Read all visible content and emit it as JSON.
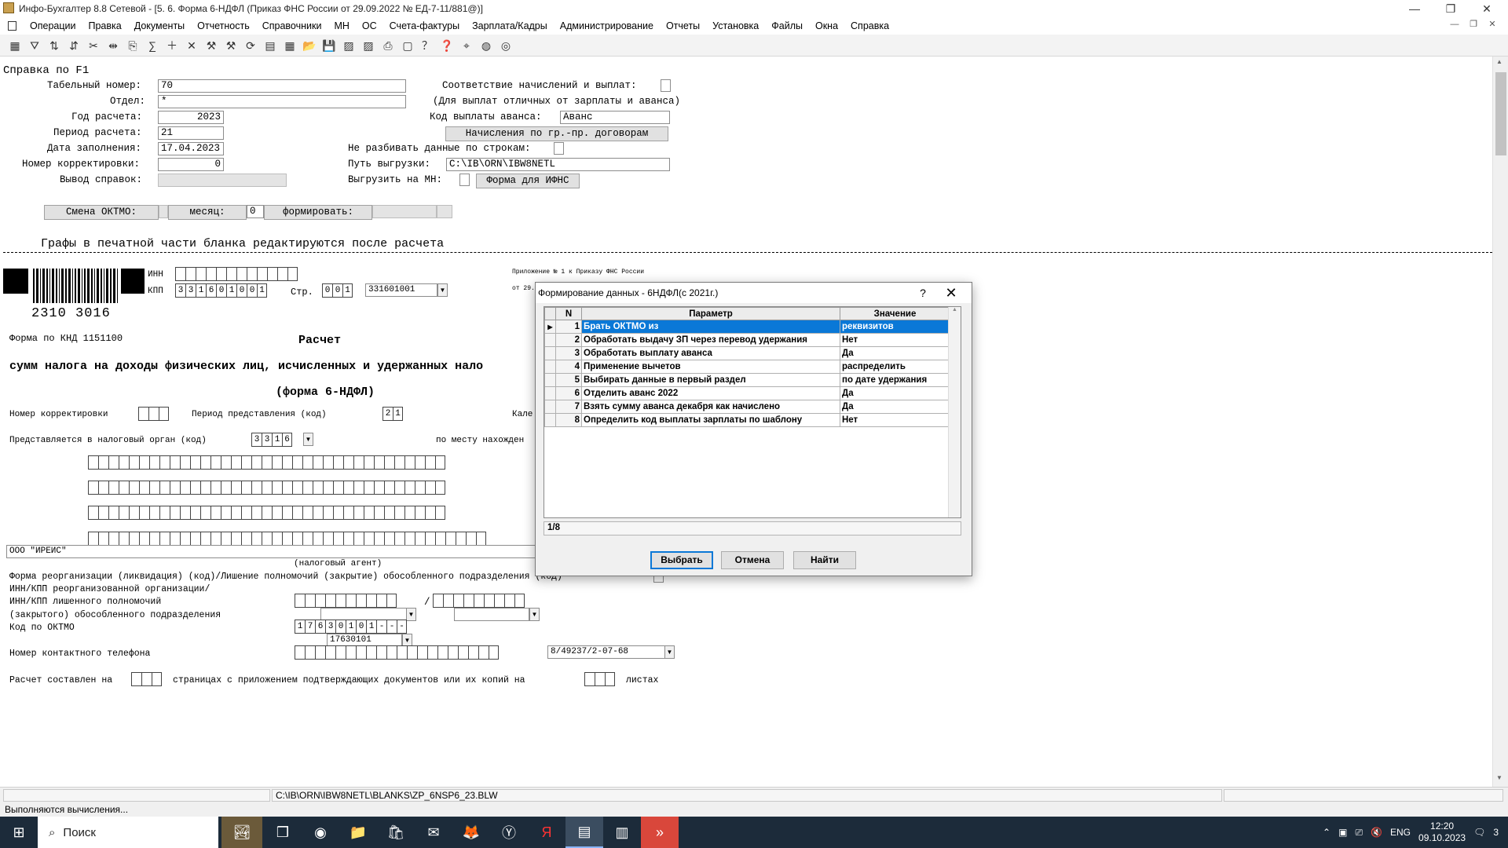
{
  "window": {
    "title": "Инфо-Бухгалтер 8.8 Сетевой - [5. 6. Форма 6-НДФЛ (Приказ ФНС России от 29.09.2022 № ЕД-7-11/881@)]",
    "minimize": "—",
    "maximize": "❐",
    "close": "✕"
  },
  "menu": {
    "items": [
      "Операции",
      "Правка",
      "Документы",
      "Отчетность",
      "Справочники",
      "МН",
      "ОС",
      "Счета-фактуры",
      "Зарплата/Кадры",
      "Администрирование",
      "Отчеты",
      "Установка",
      "Файлы",
      "Окна",
      "Справка"
    ]
  },
  "toolbar": {
    "icons": [
      "grid-icon",
      "filter-icon",
      "sort-asc-icon",
      "sort-desc-icon",
      "cut-icon",
      "split-icon",
      "copy-icon",
      "calc-icon",
      "add-icon",
      "delete-icon",
      "tool1-icon",
      "tool2-icon",
      "refresh-icon",
      "pdf-icon",
      "excel-icon",
      "open-icon",
      "save-icon",
      "disabled1-icon",
      "disabled2-icon",
      "print-icon",
      "preview-icon",
      "help-icon",
      "help2-icon",
      "compass-icon",
      "globe-icon",
      "network-icon"
    ]
  },
  "form": {
    "section_title": "Справка по F1",
    "tab_number_label": "Табельный номер:",
    "tab_number": "70",
    "dept_label": "Отдел:",
    "dept": "*",
    "year_label": "Год расчета:",
    "year": "2023",
    "period_label": "Период расчета:",
    "period": "21",
    "fill_date_label": "Дата заполнения:",
    "fill_date": "17.04.2023",
    "corr_label": "Номер корректировки:",
    "corr": "0",
    "output_label": "Вывод справок:",
    "match_label": "Соответствие начислений и выплат:",
    "match_note": "(Для выплат отличных от зарплаты и аванса)",
    "advance_code_label": "Код выплаты аванса:",
    "advance_code": "Аванс",
    "accruals_button": "Начисления по гр.-пр. договорам",
    "no_split_label": "Не разбивать данные по строкам:",
    "export_path_label": "Путь выгрузки:",
    "export_path": "C:\\IB\\ORN\\IBW8NETL",
    "export_mn_label": "Выгрузить на МН:",
    "ifns_button": "Форма для ИФНС",
    "oktmo_change": "Смена ОКТМО:",
    "month_label": "месяц:",
    "month_value": "0",
    "form_label": "формировать:",
    "edit_note": "Графы в печатной части бланка редактируются после расчета",
    "barcode_number": "2310 3016",
    "inn_label": "ИНН",
    "kpp_label": "КПП",
    "kpp_cells": [
      "3",
      "3",
      "1",
      "6",
      "0",
      "1",
      "0",
      "0",
      "1"
    ],
    "page_label": "Стр.",
    "page_cells": [
      "0",
      "0",
      "1"
    ],
    "kpp_select": "331601001",
    "appendix_note": "Приложение № 1 к Приказу ФНС России",
    "appendix_note2": "от 29.",
    "knd_label": "Форма по КНД 1151100",
    "calc_heading": "Расчет",
    "calc_sub": "сумм налога на доходы физических лиц, исчисленных и удержанных нало",
    "form_name": "(форма 6-НДФЛ)",
    "corr_number_label": "Номер корректировки",
    "period_code_label": "Период представления (код)",
    "period_code_cells": [
      "2",
      "1"
    ],
    "calendar_label": "Кале",
    "tax_org_label": "Представляется в налоговый орган (код)",
    "tax_org_cells": [
      "3",
      "3",
      "1",
      "6"
    ],
    "location_label": "по месту нахожден",
    "agent_name": "ООО \"ИРЕИС\"",
    "agent_caption": "(налоговый агент)",
    "reorg_label": "Форма реорганизации (ликвидация) (код)/Лишение полномочий (закрытие) обособленного подразделения (код)",
    "inn_kpp_reorg_label": "ИНН/КПП реорганизованной организации/",
    "inn_kpp_deprived_label": "ИНН/КПП лишенного полномочий",
    "closed_unit_label": "(закрытого) обособленного подразделения",
    "oktmo_label": "Код по ОКТМО",
    "oktmo_cells": [
      "1",
      "7",
      "6",
      "3",
      "0",
      "1",
      "0",
      "1",
      "-",
      "-",
      "-"
    ],
    "oktmo_select": "17630101",
    "phone_label": "Номер контактного телефона",
    "phone_select": "8/49237/2-07-68",
    "pages_text_a": "Расчет составлен на",
    "pages_text_b": "страницах с приложением подтверждающих документов или их копий на",
    "pages_text_c": "листах"
  },
  "dialog": {
    "title": "Формирование данных - 6НДФЛ(с 2021г.)",
    "help": "?",
    "close": "✕",
    "columns": [
      "N",
      "Параметр",
      "Значение"
    ],
    "rows": [
      {
        "n": "1",
        "param": "Брать ОКТМО из",
        "value": "реквизитов"
      },
      {
        "n": "2",
        "param": "Обработать выдачу ЗП через перевод удержания",
        "value": "Нет"
      },
      {
        "n": "3",
        "param": "Обработать выплату аванса",
        "value": "Да"
      },
      {
        "n": "4",
        "param": "Применение вычетов",
        "value": "распределить"
      },
      {
        "n": "5",
        "param": "Выбирать данные в первый раздел",
        "value": "по дате удержания"
      },
      {
        "n": "6",
        "param": "Отделить аванс 2022",
        "value": "Да"
      },
      {
        "n": "7",
        "param": "Взять сумму аванса декабря как начислено",
        "value": "Да"
      },
      {
        "n": "8",
        "param": "Определить код выплаты зарплаты по шаблону",
        "value": "Нет"
      }
    ],
    "counter": "1/8",
    "select_button": "Выбрать",
    "cancel_button": "Отмена",
    "find_button": "Найти"
  },
  "status": {
    "path": "C:\\IB\\ORN\\IBW8NETL\\BLANKS\\ZP_6NSP6_23.BLW",
    "message": "Выполняются вычисления..."
  },
  "taskbar": {
    "search_placeholder": "Поиск",
    "lang": "ENG",
    "time": "12:20",
    "date": "09.10.2023",
    "notifications": "3"
  }
}
